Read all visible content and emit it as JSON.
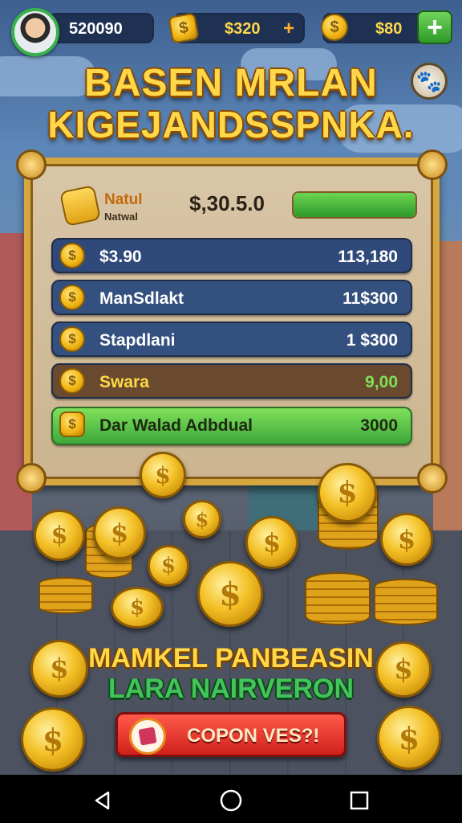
{
  "header": {
    "score": "520090",
    "currency1": "$320",
    "currency2": "$80",
    "plus1": "+",
    "plus2": "+"
  },
  "title": {
    "line1": "BASEN MRLAN",
    "line2": "KIGEJANDSSPNKA."
  },
  "panel": {
    "head_name": "Natul",
    "head_sub": "Natwal",
    "head_amount": "$,30.5.0",
    "progress": 1.0,
    "rows": [
      {
        "label": "$3.90",
        "value": "113,180",
        "bg": "#2f4a7a"
      },
      {
        "label": "ManSdlakt",
        "value": "11$300",
        "bg": "#34507f"
      },
      {
        "label": "Stapdlani",
        "value": "1 $300",
        "bg": "#34507f"
      },
      {
        "label": "Swara",
        "value": "9,00",
        "bg": "#6a4a2e"
      },
      {
        "label": "Dar Walad Adbdual",
        "value": "3000",
        "bg": "#4fb94a"
      }
    ]
  },
  "promo": {
    "line1": "MAMKEL PANBEASIN",
    "line2": "LARA NAIRVERON",
    "button_label": "COPON VES?!"
  },
  "colors": {
    "accent_gold": "#ffd84a",
    "promo_green": "#2fa34a",
    "button_red": "#d0211c"
  },
  "icons": {
    "coin": "dollar-coin-icon",
    "settings": "pet-icon",
    "nav": [
      "back-icon",
      "home-icon",
      "recents-icon"
    ]
  }
}
